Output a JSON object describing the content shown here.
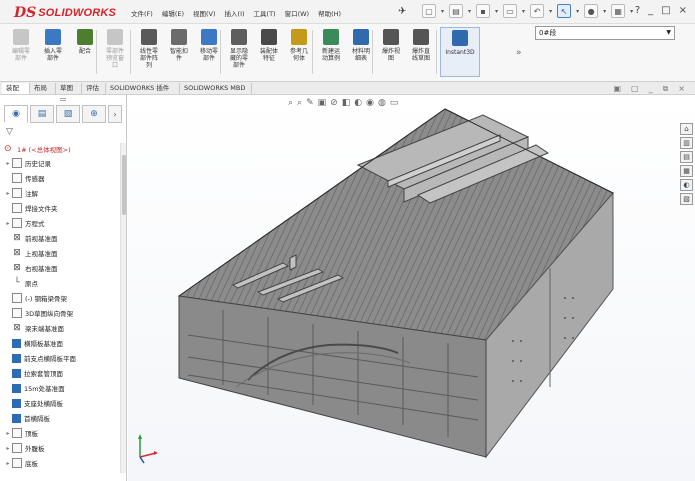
{
  "app": {
    "logo_mark": "DS",
    "logo_text": "SOLIDWORKS"
  },
  "menu": [
    "文件(F)",
    "编辑(E)",
    "视图(V)",
    "插入(I)",
    "工具(T)",
    "窗口(W)",
    "帮助(H)"
  ],
  "quick_access": [
    {
      "icon": "new-icon",
      "glyph": "▢"
    },
    {
      "icon": "open-icon",
      "glyph": "▤"
    },
    {
      "icon": "save-icon",
      "glyph": "▪"
    },
    {
      "icon": "print-icon",
      "glyph": "▭"
    },
    {
      "icon": "undo-icon",
      "glyph": "↶"
    },
    {
      "icon": "select-icon",
      "glyph": "↖"
    },
    {
      "icon": "rebuild-icon",
      "glyph": "●"
    },
    {
      "icon": "options-icon",
      "glyph": "▦"
    }
  ],
  "window_controls": {
    "help": "?",
    "minimize": "_",
    "restore": "□",
    "close": "×"
  },
  "ribbon": {
    "buttons": [
      {
        "label": "编辑零\n部件",
        "dim": true,
        "color": "#8a8a8a"
      },
      {
        "label": "插入零\n部件",
        "dim": false,
        "color": "#3c78c3"
      },
      {
        "label": "配合",
        "dim": false,
        "color": "#4d7d2e"
      },
      {
        "label": "零部件\n预览窗\n口",
        "dim": true,
        "color": "#8a8a8a"
      },
      {
        "label": "线性零\n部件阵\n列",
        "dim": false,
        "color": "#5a5a5a"
      },
      {
        "label": "智能扣\n件",
        "dim": false,
        "color": "#6b6b6b"
      },
      {
        "label": "移动零\n部件",
        "dim": false,
        "color": "#3c78c3"
      },
      {
        "label": "显示隐\n藏的零\n部件",
        "dim": false,
        "color": "#5e5e5e"
      },
      {
        "label": "装配体\n特征",
        "dim": false,
        "color": "#4a4a4a"
      },
      {
        "label": "参考几\n何体",
        "dim": false,
        "color": "#c49a1a"
      },
      {
        "label": "新建运\n动算例",
        "dim": false,
        "color": "#3a8a5a"
      },
      {
        "label": "材料明\n细表",
        "dim": false,
        "color": "#2f6aad"
      },
      {
        "label": "爆炸视\n图",
        "dim": false,
        "color": "#555555"
      },
      {
        "label": "爆炸直\n线草图",
        "dim": false,
        "color": "#555555"
      },
      {
        "label": "Instant3D",
        "dim": false,
        "color": "#2f6aad",
        "active": true
      }
    ],
    "more": "»",
    "config_select": "0#段"
  },
  "command_tabs": [
    {
      "label": "装配体",
      "active": true
    },
    {
      "label": "布局",
      "active": false
    },
    {
      "label": "草图",
      "active": false
    },
    {
      "label": "评估",
      "active": false
    },
    {
      "label": "SOLIDWORKS 插件",
      "active": false
    },
    {
      "label": "SOLIDWORKS MBD",
      "active": false
    }
  ],
  "viewport_controls": [
    "▣",
    "▢",
    "_",
    "⧉",
    "×"
  ],
  "heads_up_toolbar": [
    "⌕",
    "⌕",
    "✎",
    "▣",
    "⊘",
    "◧",
    "◐",
    "◉",
    "◍",
    "▭"
  ],
  "task_pane": [
    "⌂",
    "▥",
    "▤",
    "▦",
    "◐",
    "▧"
  ],
  "feature_tree": {
    "root": {
      "label": "1# (<总体视图>)"
    },
    "items": [
      {
        "label": "历史记录",
        "icon": "folder",
        "expander": "▸"
      },
      {
        "label": "传感器",
        "icon": "folder",
        "expander": ""
      },
      {
        "label": "注解",
        "icon": "folder",
        "expander": "▸"
      },
      {
        "label": "焊接文件夹",
        "icon": "folder",
        "expander": ""
      },
      {
        "label": "方程式",
        "icon": "folder",
        "expander": "▸"
      },
      {
        "label": "前视基准面",
        "icon": "plane",
        "expander": ""
      },
      {
        "label": "上视基准面",
        "icon": "plane",
        "expander": ""
      },
      {
        "label": "右视基准面",
        "icon": "plane",
        "expander": ""
      },
      {
        "label": "原点",
        "icon": "origin",
        "expander": ""
      },
      {
        "label": "(-) 钢箱梁骨架",
        "icon": "folder",
        "expander": ""
      },
      {
        "label": "3D草图纵向骨架",
        "icon": "folder",
        "expander": ""
      },
      {
        "label": "梁末端基准面",
        "icon": "plane",
        "expander": ""
      },
      {
        "label": "横隔板基准面",
        "icon": "blue",
        "expander": ""
      },
      {
        "label": "前支点横隔板平面",
        "icon": "blue",
        "expander": ""
      },
      {
        "label": "拉索套管顶面",
        "icon": "blue",
        "expander": ""
      },
      {
        "label": "15m处基准面",
        "icon": "blue",
        "expander": ""
      },
      {
        "label": "支座处横隔板",
        "icon": "blue",
        "expander": ""
      },
      {
        "label": "首横隔板",
        "icon": "blue",
        "expander": ""
      },
      {
        "label": "顶板",
        "icon": "folder",
        "expander": "▸"
      },
      {
        "label": "外腹板",
        "icon": "folder",
        "expander": "▸"
      },
      {
        "label": "底板",
        "icon": "folder",
        "expander": "▸"
      }
    ]
  }
}
